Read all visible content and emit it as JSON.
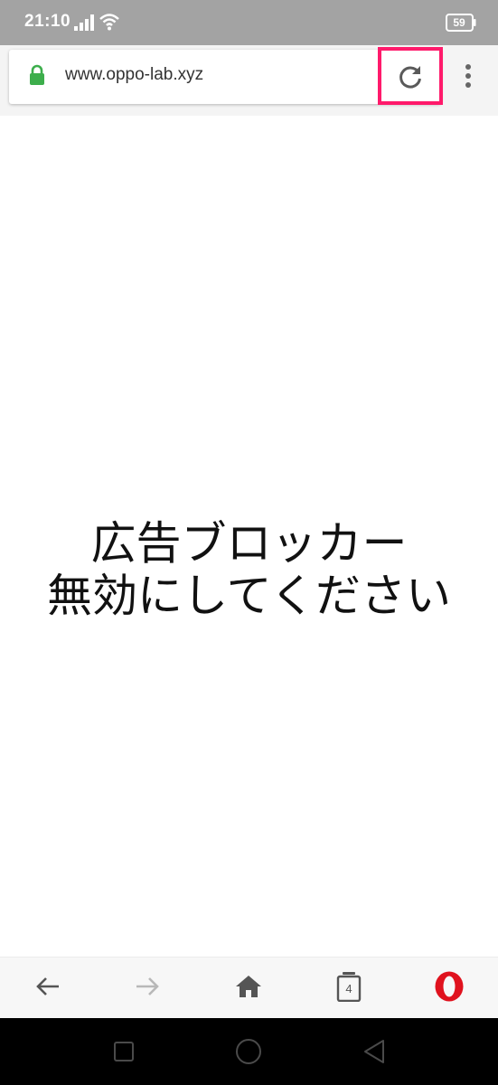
{
  "status_bar": {
    "time": "21:10",
    "battery_level": "59",
    "icons": [
      "signal-icon",
      "wifi-icon",
      "battery-icon"
    ]
  },
  "browser_toolbar": {
    "url": "www.oppo-lab.xyz",
    "icons": [
      "lock-icon",
      "reload-icon",
      "more-vert-icon"
    ],
    "reload_highlighted": true
  },
  "page": {
    "message_line1": "広告ブロッカー",
    "message_line2": "無効にしてください"
  },
  "bottom_nav": {
    "tab_count": "4",
    "icons": [
      "back-arrow-icon",
      "forward-arrow-icon",
      "home-icon",
      "tabs-icon",
      "opera-logo-icon"
    ]
  },
  "system_nav": {
    "icons": [
      "recents-icon",
      "home-circle-icon",
      "back-triangle-icon"
    ]
  },
  "colors": {
    "highlight": "#ff1a6b",
    "lock": "#3dae4c",
    "opera": "#e0121e",
    "status_bar": "#a3a3a3"
  }
}
